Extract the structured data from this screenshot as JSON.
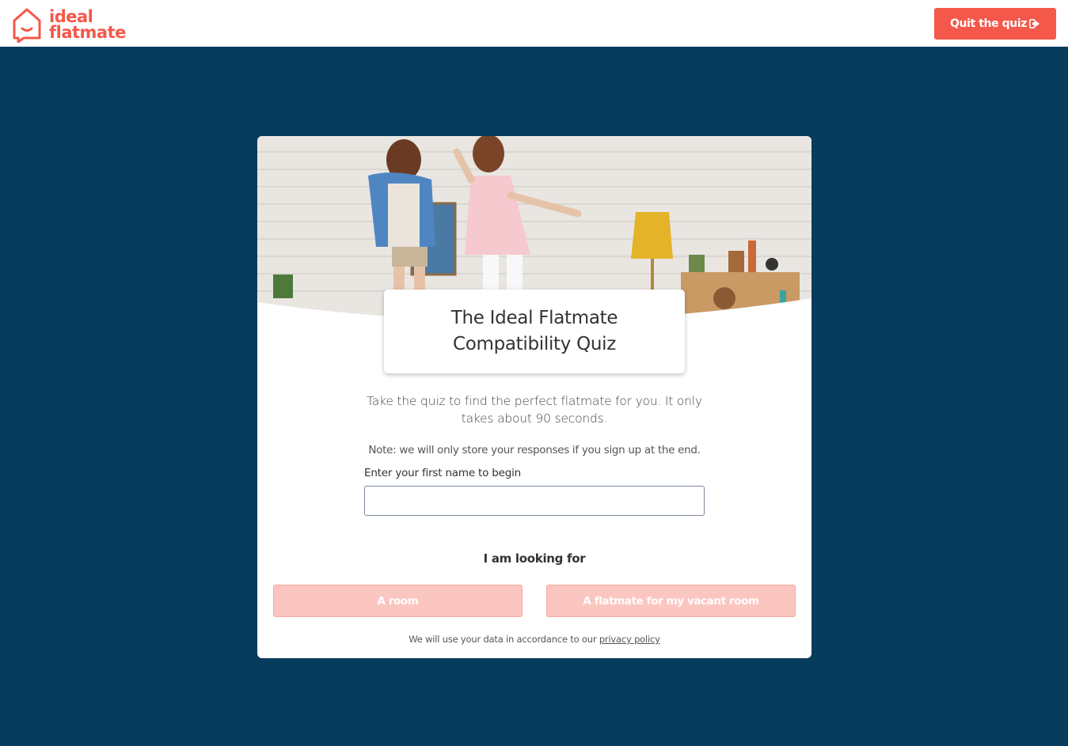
{
  "brand": {
    "line1": "ideal",
    "line2": "flatmate",
    "accent_color": "#f4584a"
  },
  "header": {
    "quit_label": "Quit the quiz",
    "quit_icon": "sign-out-icon"
  },
  "quiz": {
    "title_line1": "The Ideal Flatmate",
    "title_line2": "Compatibility Quiz",
    "intro": "Take the quiz to find the perfect flatmate for you. It only takes about 90 seconds.",
    "note": "Note: we will only store your responses if you sign up at the end.",
    "name_label": "Enter your first name to begin",
    "name_value": "",
    "looking_for_label": "I am looking for",
    "options": [
      "A room",
      "A flatmate for my vacant room"
    ],
    "privacy_prefix": "We will use your data in accordance to our ",
    "privacy_link": "privacy policy"
  },
  "colors": {
    "background": "#083c5d",
    "button_disabled": "#fcc6c0"
  }
}
